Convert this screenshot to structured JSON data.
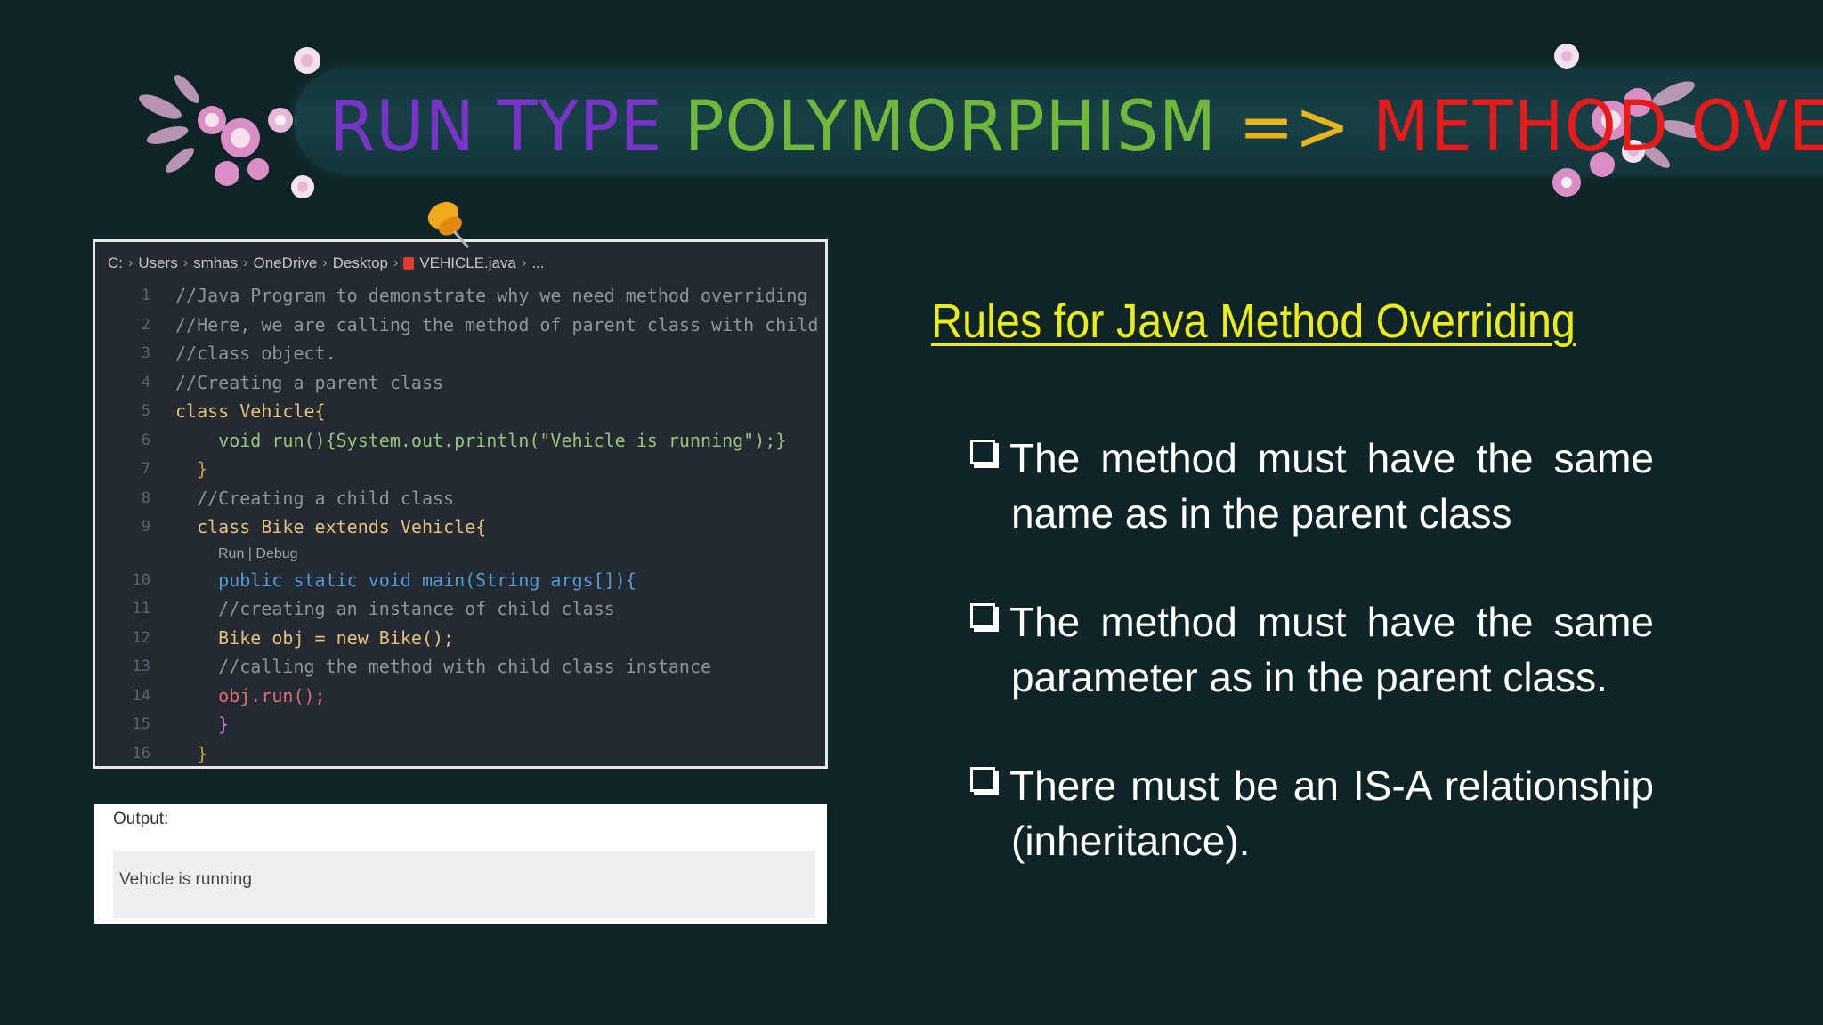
{
  "title": {
    "part1": "RUN TYPE",
    "part2": "POLYMORPHISM",
    "arrow": "=>",
    "part3": "METHOD OVE"
  },
  "code_window": {
    "breadcrumb": [
      "C:",
      "Users",
      "smhas",
      "OneDrive",
      "Desktop",
      "VEHICLE.java",
      "..."
    ],
    "codelens": "Run | Debug",
    "lines": [
      {
        "n": "1",
        "text": "//Java Program to demonstrate why we need method overriding"
      },
      {
        "n": "2",
        "text": "//Here, we are calling the method of parent class with child"
      },
      {
        "n": "3",
        "text": "//class object."
      },
      {
        "n": "4",
        "text": "//Creating a parent class"
      },
      {
        "n": "5",
        "text": "class Vehicle{"
      },
      {
        "n": "6",
        "text": "    void run(){System.out.println(\"Vehicle is running\");}"
      },
      {
        "n": "7",
        "text": "  }"
      },
      {
        "n": "8",
        "text": "  //Creating a child class"
      },
      {
        "n": "9",
        "text": "  class Bike extends Vehicle{"
      },
      {
        "n": "10",
        "text": "    public static void main(String args[]){"
      },
      {
        "n": "11",
        "text": "    //creating an instance of child class"
      },
      {
        "n": "12",
        "text": "    Bike obj = new Bike();"
      },
      {
        "n": "13",
        "text": "    //calling the method with child class instance"
      },
      {
        "n": "14",
        "text": "    obj.run();"
      },
      {
        "n": "15",
        "text": "    }"
      },
      {
        "n": "16",
        "text": "  }"
      }
    ]
  },
  "output": {
    "label": "Output:",
    "text": "Vehicle is running"
  },
  "rules": {
    "title": "Rules for Java Method Overriding",
    "items": [
      "The method must have the same name as in the parent class",
      "The method must have the same parameter as in the parent class.",
      "There must be an IS-A relationship (inheritance)."
    ]
  },
  "colors": {
    "background": "#0f2426",
    "title_purple": "#7a33c9",
    "title_green": "#6fb83a",
    "title_arrow": "#e7b41b",
    "title_red": "#e81a1a",
    "rules_title": "#ecec16"
  }
}
